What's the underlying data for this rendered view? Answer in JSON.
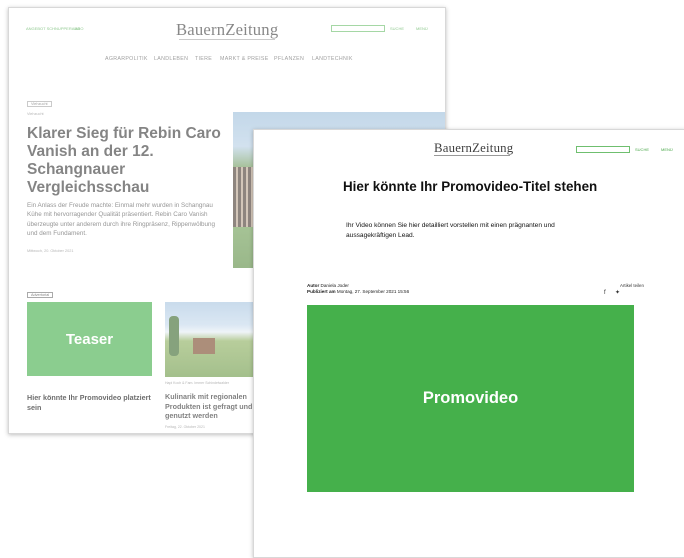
{
  "back": {
    "topbar": {
      "left_links": [
        "ANGEBOT SCHNUPPERABO",
        "ABO"
      ],
      "search_label": "SUCHE",
      "menu_label": "MENÜ"
    },
    "logo": {
      "first": "Bauern",
      "second": "Zeitung"
    },
    "nav": [
      "AGRARPOLITIK",
      "LANDLEBEN",
      "TIERE",
      "MARKT & PREISE",
      "PFLANZEN",
      "LANDTECHNIK"
    ],
    "article": {
      "tag": "Viehzucht",
      "kicker": "Viehzucht",
      "title": "Klarer Sieg für Rebin Caro Vanish an der 12. Schangnauer Vergleichsschau",
      "lead": "Ein Anlass der Freude machte: Einmal mehr wurden in Schangnau Kühe mit hervorragender Qualität präsentiert. Rebin Caro Vanish überzeugte unter anderem durch ihre Ringpräsenz, Rippenwölbung und dem Fundament.",
      "date": "Mittwoch, 20. Oktober 2021"
    },
    "teaser": {
      "badge": "Advertorial",
      "box_label": "Teaser",
      "caption": "Hier könnte Ihr Promovideo platziert sein"
    },
    "second": {
      "caption": "Hapi Koch & Fam. Immer Schindelwalder",
      "title": "Kulinarik mit regionalen Produkten ist gefragt und genutzt werden",
      "date": "Freitag, 22. Oktober 2021"
    }
  },
  "front": {
    "logo": {
      "first": "Bauern",
      "second": "Zeitung"
    },
    "search_label": "SUCHE",
    "menu_label": "MENÜ",
    "title": "Hier könnte Ihr Promovideo-Titel stehen",
    "lead": "Ihr Video können Sie hier detailliert vorstellen mit einen prägnanten und aussagekräftigen Lead.",
    "author_label": "Autor",
    "author_name": "Daniela Joder",
    "published_label": "Publiziert am",
    "published_date": "Montag, 27. September 2021 15:56",
    "share_label": "Artikel teilen",
    "video_label": "Promovideo"
  },
  "colors": {
    "green": "#45b04b",
    "link_green": "#4aa84a"
  }
}
